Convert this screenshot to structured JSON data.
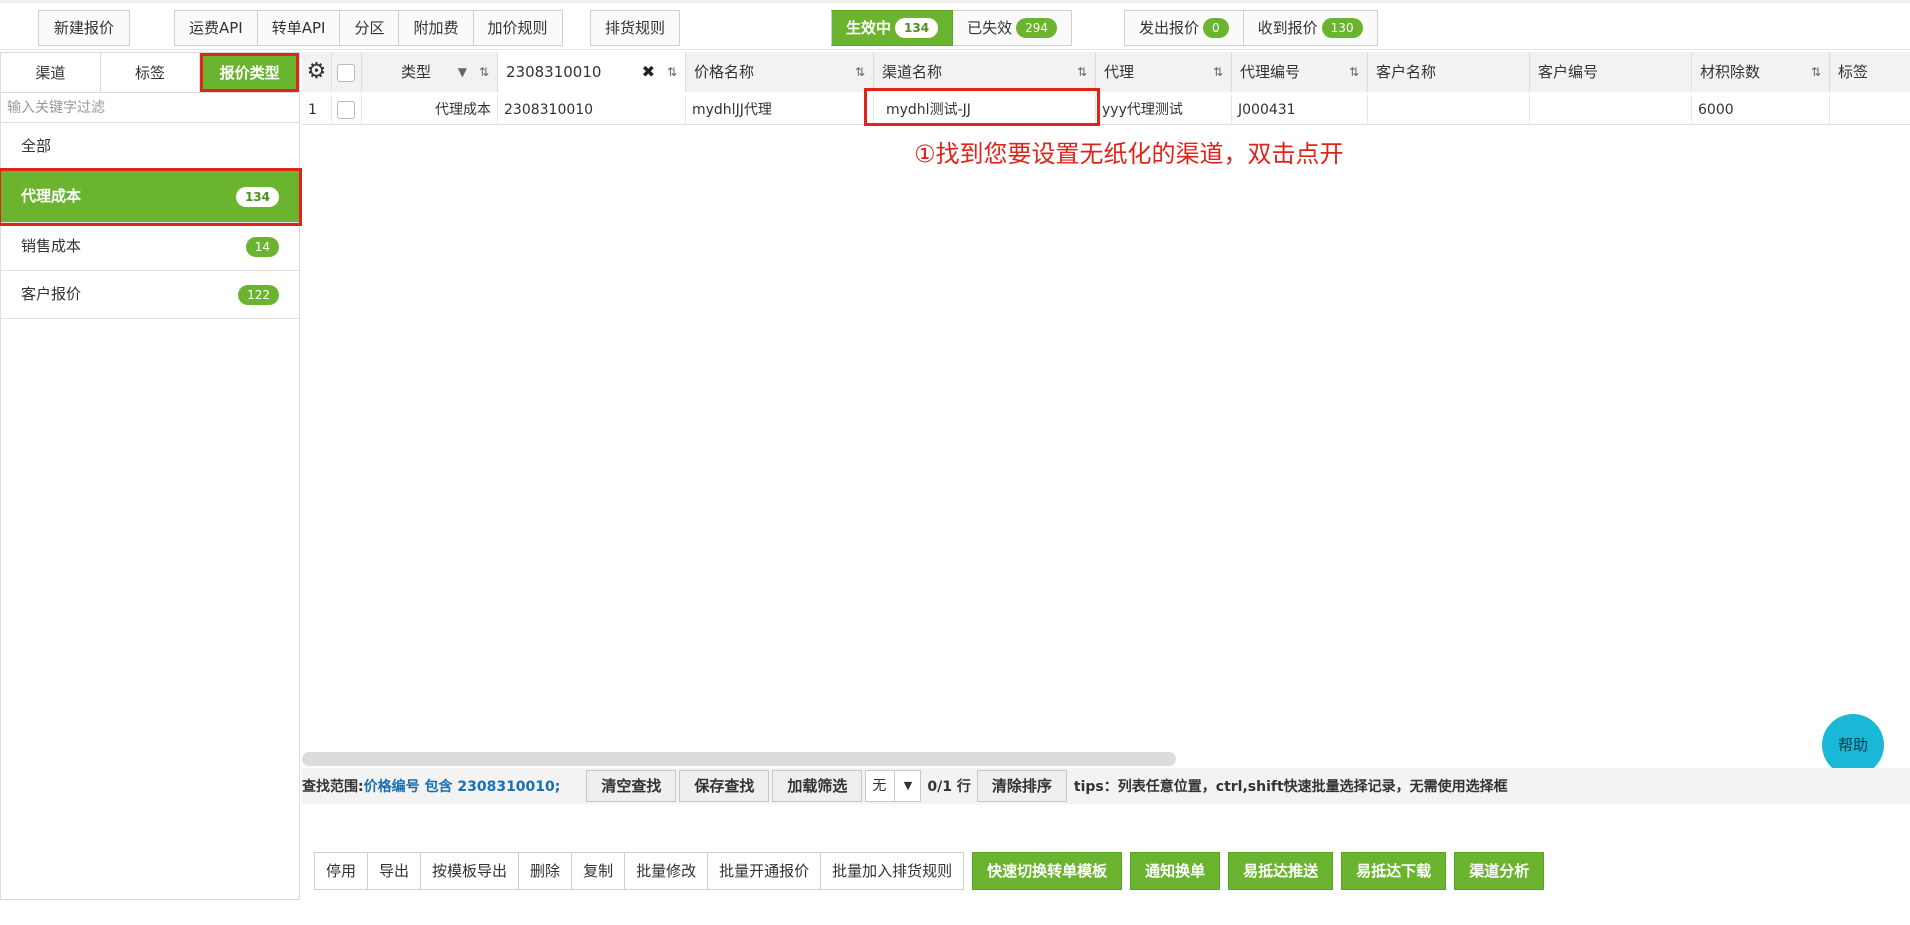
{
  "toolbar": {
    "new_quote": "新建报价",
    "group1": [
      "运费API",
      "转单API",
      "分区",
      "附加费",
      "加价规则"
    ],
    "ship_rule": "排货规则",
    "status": {
      "active_label": "生效中",
      "active_count": "134",
      "expired_label": "已失效",
      "expired_count": "294"
    },
    "quotes": {
      "sent_label": "发出报价",
      "sent_count": "0",
      "received_label": "收到报价",
      "received_count": "130"
    }
  },
  "sidebar": {
    "tabs": [
      "渠道",
      "标签",
      "报价类型"
    ],
    "filter_placeholder": "输入关键字过滤",
    "items": [
      {
        "label": "全部",
        "count": ""
      },
      {
        "label": "代理成本",
        "count": "134"
      },
      {
        "label": "销售成本",
        "count": "14"
      },
      {
        "label": "客户报价",
        "count": "122"
      }
    ]
  },
  "table": {
    "columns": {
      "type": "类型",
      "price_no": "2308310010",
      "price_name": "价格名称",
      "channel_name": "渠道名称",
      "agent": "代理",
      "agent_no": "代理编号",
      "customer_name": "客户名称",
      "customer_no": "客户编号",
      "vol_divisor": "材积除数",
      "tag": "标签"
    },
    "rows": [
      {
        "idx": "1",
        "type": "代理成本",
        "price_no": "2308310010",
        "price_name": "mydhlJJ代理",
        "channel_name": "mydhl测试-JJ",
        "agent": "yyy代理测试",
        "agent_no": "J000431",
        "customer_name": "",
        "customer_no": "",
        "vol_divisor": "6000",
        "tag": ""
      }
    ]
  },
  "annotation": "①找到您要设置无纸化的渠道，双击点开",
  "help": "帮助",
  "statusbar": {
    "label": "查找范围:",
    "scope": "价格编号 包含 2308310010;",
    "clear_search": "清空查找",
    "save_search": "保存查找",
    "load_filter": "加载筛选",
    "select_value": "无",
    "rows": "0/1 行",
    "clear_sort": "清除排序",
    "tips": "tips：列表任意位置，ctrl,shift快速批量选择记录，无需使用选择框"
  },
  "actions": {
    "plain": [
      "停用",
      "导出",
      "按模板导出",
      "删除",
      "复制",
      "批量修改",
      "批量开通报价",
      "批量加入排货规则"
    ],
    "green": [
      "快速切换转单模板",
      "通知换单",
      "易抵达推送",
      "易抵达下载",
      "渠道分析"
    ]
  },
  "colors": {
    "accent": "#6ab42f",
    "highlight": "#e2231a",
    "help": "#1bb7d6"
  }
}
